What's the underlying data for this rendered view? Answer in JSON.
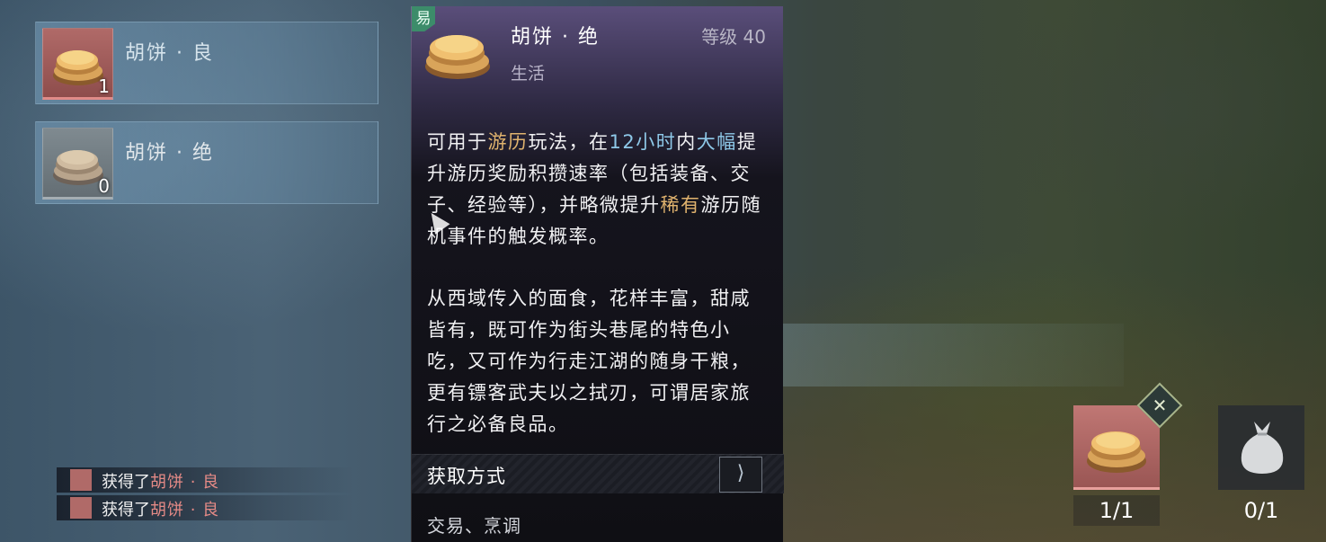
{
  "inventory": {
    "items": [
      {
        "name": "胡饼 · 良",
        "count": "1"
      },
      {
        "name": "胡饼 · 绝",
        "count": "0"
      }
    ]
  },
  "detail": {
    "tradeable_tag": "易",
    "name": "胡饼 · 绝",
    "level": "等级 40",
    "category": "生活",
    "effect": {
      "p1": "可用于",
      "h1": "游历",
      "p2": "玩法，在",
      "h2": "12小时",
      "p3": "内",
      "h3": "大幅",
      "p4": "提升游历奖励积攒速率（包括装备、交子、经验等），并略微提升",
      "h4": "稀有",
      "p5": "游历随机事件的触发概率。"
    },
    "lore": "从西域传入的面食，花样丰富，甜咸皆有，既可作为街头巷尾的特色小吃，又可作为行走江湖的随身干粮，更有镖客武夫以之拭刃，可谓居家旅行之必备良品。",
    "source_label": "获取方式",
    "source_arrow": "⟩",
    "source_value": "交易、烹调"
  },
  "notifications": [
    {
      "prefix": "获得了",
      "item": "胡饼 · 良"
    },
    {
      "prefix": "获得了",
      "item": "胡饼 · 良"
    }
  ],
  "slots": [
    {
      "count": "1/1",
      "icon": "huobing-cake-icon"
    },
    {
      "count": "0/1",
      "icon": "cloth-bundle-icon"
    }
  ],
  "equip_badge": "✕"
}
